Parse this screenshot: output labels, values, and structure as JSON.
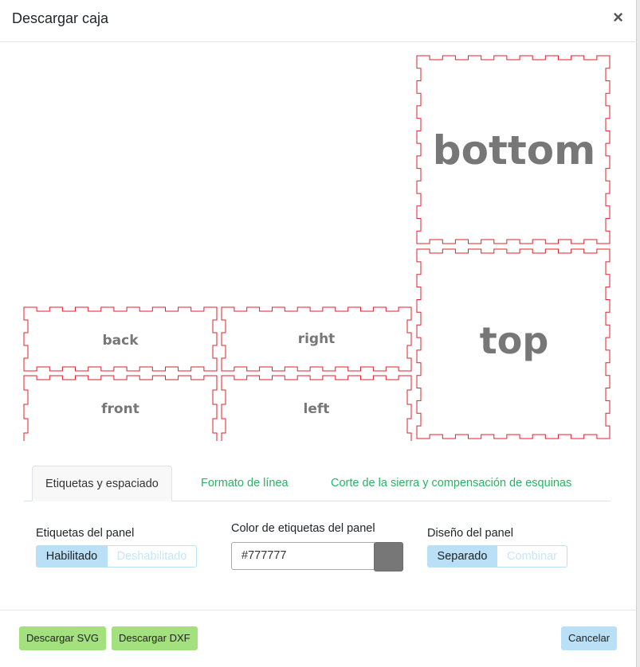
{
  "modal": {
    "title": "Descargar caja",
    "close_glyph": "×"
  },
  "preview": {
    "stroke_color": "#e0202a",
    "label_color": "#777777",
    "panels": {
      "bottom": "bottom",
      "top": "top",
      "back": "back",
      "right": "right",
      "front": "front",
      "left": "left"
    }
  },
  "tabs": [
    {
      "label": "Etiquetas y espaciado",
      "active": true
    },
    {
      "label": "Formato de línea",
      "active": false
    },
    {
      "label": "Corte de la sierra y compensación de esquinas",
      "active": false
    }
  ],
  "options": {
    "panel_labels": {
      "label": "Etiquetas del panel",
      "enabled": "Habilitado",
      "disabled": "Deshabilitado",
      "selected": "Habilitado"
    },
    "label_color": {
      "label": "Color de etiquetas del panel",
      "value": "#777777",
      "swatch": "#777777"
    },
    "panel_layout": {
      "label": "Diseño del panel",
      "separate": "Separado",
      "combine": "Combinar",
      "selected": "Separado"
    }
  },
  "footer": {
    "download_svg": "Descargar SVG",
    "download_dxf": "Descargar DXF",
    "cancel": "Cancelar"
  }
}
